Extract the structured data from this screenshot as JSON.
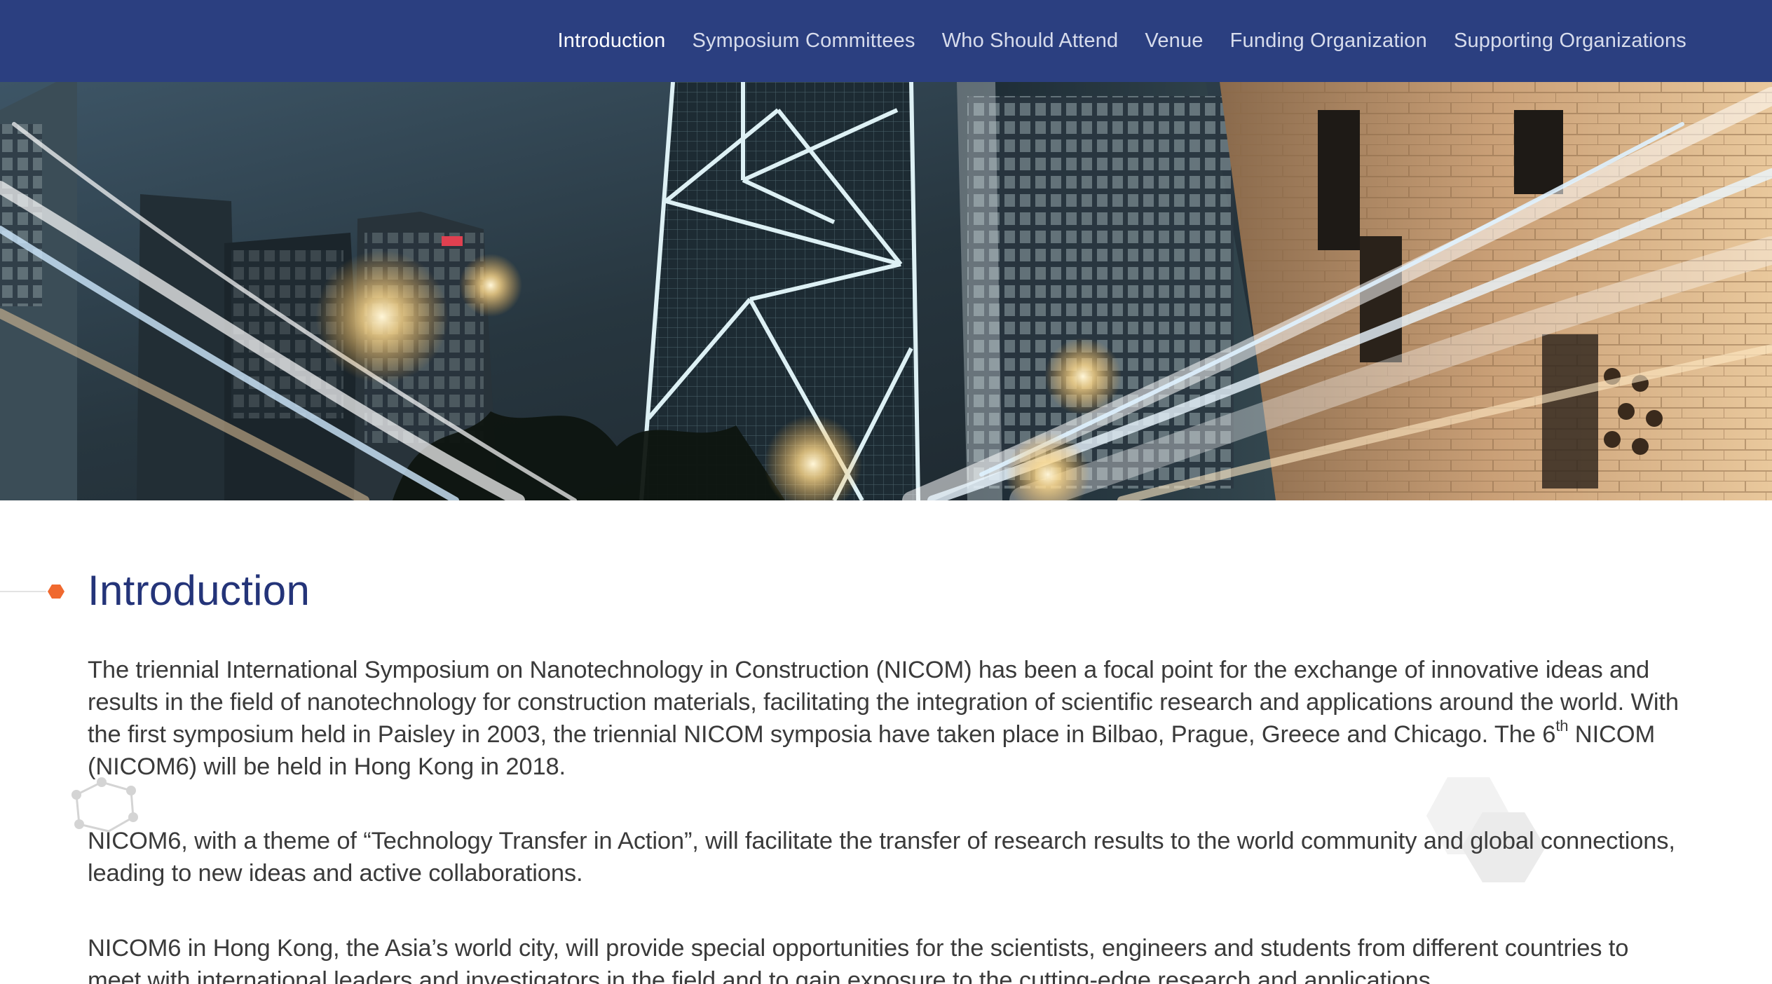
{
  "nav": {
    "items": [
      {
        "label": "Introduction",
        "active": true
      },
      {
        "label": "Symposium Committees",
        "active": false
      },
      {
        "label": "Who Should Attend",
        "active": false
      },
      {
        "label": "Venue",
        "active": false
      },
      {
        "label": "Funding Organization",
        "active": false
      },
      {
        "label": "Supporting Organizations",
        "active": false
      }
    ]
  },
  "colors": {
    "nav_bg": "#2b3f80",
    "title": "#243479",
    "accent_dot": "#f0692f",
    "body_text": "#3a3a3a"
  },
  "hero": {
    "image_subject": "night-city-skyline-light-trails"
  },
  "section": {
    "title": "Introduction",
    "p1_before": "The triennial International Symposium on Nanotechnology in Construction (NICOM) has been a focal point for the exchange of innovative ideas and results in the field of nanotechnology for construction materials, facilitating the integration of scientific research and applications around the world. With the first symposium held in Paisley in 2003, the triennial NICOM symposia have taken place in Bilbao, Prague, Greece and Chicago. The 6",
    "p1_sup": "th",
    "p1_after": " NICOM (NICOM6) will be held in Hong Kong in 2018.",
    "p2": "NICOM6, with a theme of “Technology Transfer in Action”, will facilitate the transfer of research results to the world community and global connections, leading to new ideas and active collaborations.",
    "p3": "NICOM6 in Hong Kong, the Asia’s world city, will provide special opportunities for the scientists, engineers and students from different countries to meet with international leaders and investigators in the field and to gain exposure to the cutting-edge research and applications."
  }
}
